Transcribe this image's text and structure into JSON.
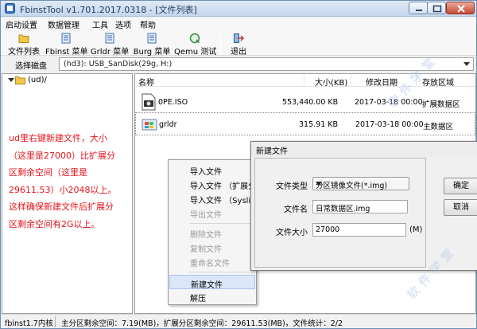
{
  "window": {
    "title": "FbinstTool v1.701.2017.0318 - [文件列表]"
  },
  "menu": [
    "启动设置",
    "数据管理",
    "工具",
    "选项",
    "帮助"
  ],
  "toolbar": {
    "file_list": "文件列表",
    "fbinst_menu": "Fbinst 菜单",
    "grldr_menu": "Grldr 菜单",
    "burg_menu": "Burg 菜单",
    "qemu_test": "Qemu 测试",
    "exit": "退出"
  },
  "disk": {
    "label": "选择磁盘",
    "value": "(hd3): USB_SanDisk(29g, H:)"
  },
  "tree": {
    "root": "(ud)/"
  },
  "note": "ud里右键新建文件，大小\n（这里是27000）比扩展分\n区剩余空间（这里是\n29611.53）小2048以上。\n这样确保新建文件后扩展分\n区剩余空间有2G以上。",
  "files": {
    "columns": {
      "name": "名称",
      "size": "大小(KB)",
      "modified": "修改日期",
      "area": "存放区域"
    },
    "rows": [
      {
        "name": "0PE.ISO",
        "size": "553,440.00 KB",
        "modified": "2017-03-18 00:00",
        "area": "扩展数据区",
        "icon": "iso-file-icon"
      },
      {
        "name": "grldr",
        "size": "315.91 KB",
        "modified": "2017-03-18 00:00",
        "area": "主数据区",
        "icon": "windows-file-icon"
      }
    ]
  },
  "context_menu": {
    "items": [
      {
        "label": "导入文件",
        "disabled": false
      },
      {
        "label": "导入文件 （扩展分",
        "disabled": false
      },
      {
        "label": "导入文件 （Syslin",
        "disabled": false
      },
      {
        "label": "导出文件",
        "disabled": true
      },
      {
        "label": "删除文件",
        "disabled": true
      },
      {
        "label": "复制文件",
        "disabled": true
      },
      {
        "label": "重命名文件",
        "disabled": true
      },
      {
        "label": "新建文件",
        "disabled": false
      },
      {
        "label": "解压",
        "disabled": false
      }
    ]
  },
  "dialog": {
    "title": "新建文件",
    "type_label": "文件类型",
    "type_value": "分区镜像文件(*.img)",
    "name_label": "文件名",
    "name_value": "日常数据区.img",
    "size_label": "文件大小",
    "size_value": "27000",
    "size_unit": "(M)",
    "ok": "确定",
    "cancel": "取消"
  },
  "status": {
    "left": "fbinst1.7内核",
    "right": "主分区剩余空间：7.19(MB)，扩展分区剩余空间：29611.53(MB)，文件统计：2/2"
  },
  "watermark": {
    "text": "软件学堂"
  },
  "colors": {
    "note": "#e8141c",
    "title_bar": "#c5d7ee",
    "close_button": "#c74a32",
    "menu_hover": "#dbe7f8"
  }
}
